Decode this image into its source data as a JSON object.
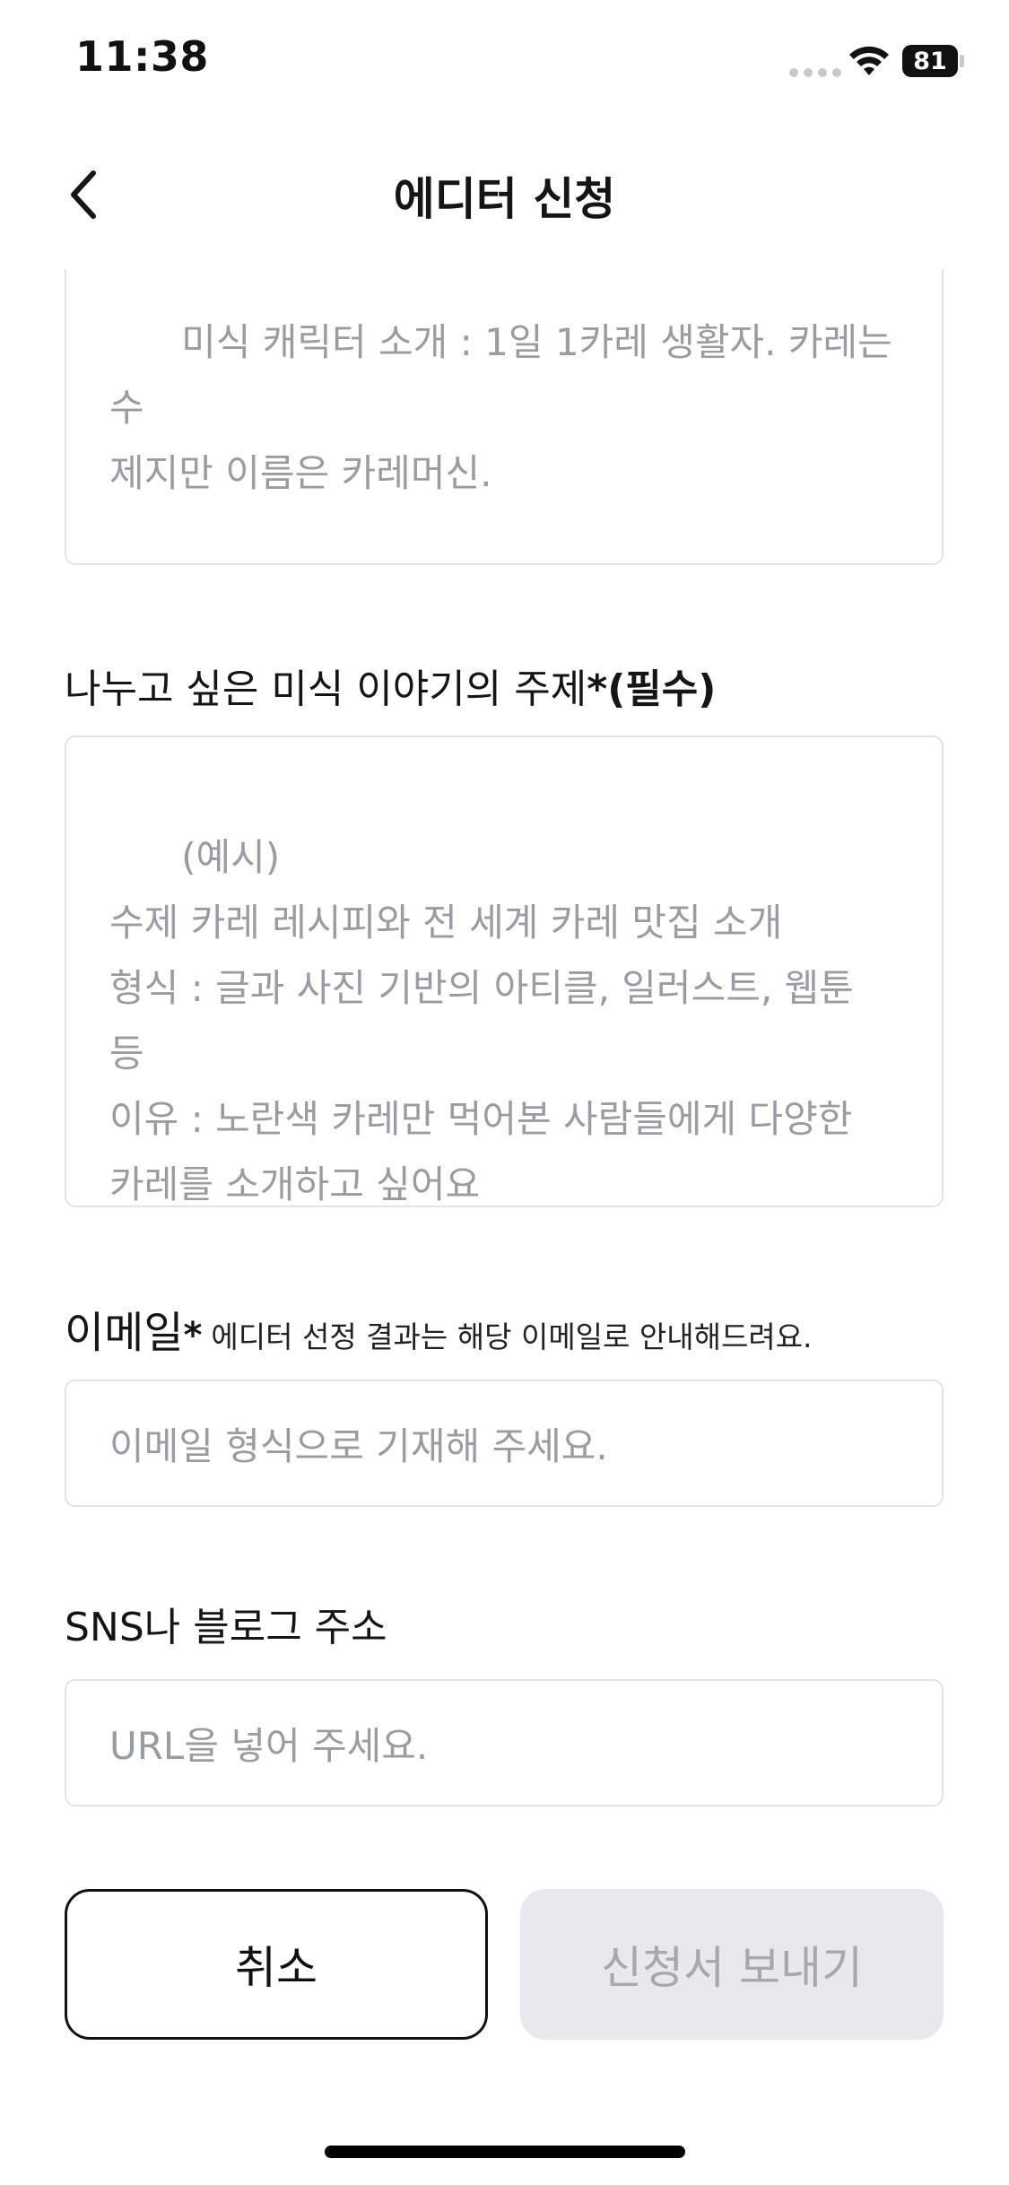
{
  "status_bar": {
    "time": "11:38",
    "battery_level": "81"
  },
  "header": {
    "title": "에디터 신청",
    "back_icon": "chevron-left-icon"
  },
  "form": {
    "character_intro": {
      "placeholder": "미식 캐릭터 소개 : 1일 1카레 생활자. 카레는 수\n제지만 이름은 카레머신."
    },
    "topic": {
      "label": "나누고 싶은 미식 이야기의 주제",
      "required_mark": "*(필수)",
      "placeholder": "(예시)\n수제 카레 레시피와 전 세계 카레 맛집 소개\n형식 : 글과 사진 기반의 아티클, 일러스트, 웹툰\n등\n이유 : 노란색 카레만 먹어본 사람들에게 다양한\n카레를 소개하고 싶어요"
    },
    "email": {
      "label": "이메일",
      "required_mark": "*",
      "hint": "에디터 선정 결과는 해당 이메일로 안내해드려요.",
      "placeholder": "이메일 형식으로 기재해 주세요.",
      "value": ""
    },
    "sns": {
      "label": "SNS나 블로그 주소",
      "placeholder": "URL을 넣어 주세요.",
      "value": ""
    }
  },
  "actions": {
    "cancel_label": "취소",
    "submit_label": "신청서 보내기"
  },
  "colors": {
    "border": "#e2e3e7",
    "placeholder": "#9a9ca3",
    "submit_disabled_bg": "#e8e9ed",
    "submit_disabled_text": "#a6a8ae"
  }
}
